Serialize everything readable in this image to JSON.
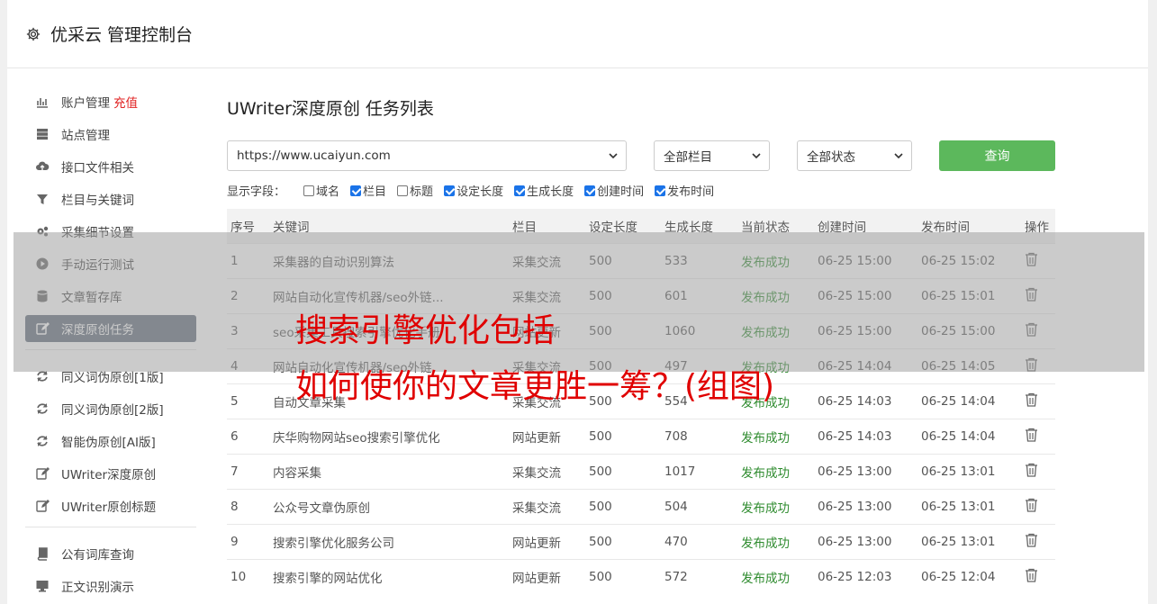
{
  "app": {
    "title": "优采云 管理控制台"
  },
  "sidebar": {
    "items": [
      {
        "label": "账户管理",
        "badge": "充值",
        "icon": "bar-chart-icon"
      },
      {
        "label": "站点管理",
        "icon": "server-icon"
      },
      {
        "label": "接口文件相关",
        "icon": "cloud-upload-icon"
      },
      {
        "label": "栏目与关键词",
        "icon": "filter-icon"
      },
      {
        "label": "采集细节设置",
        "icon": "gears-icon"
      },
      {
        "label": "手动运行测试",
        "icon": "play-icon"
      },
      {
        "label": "文章暂存库",
        "icon": "database-icon"
      },
      {
        "label": "深度原创任务",
        "icon": "edit-icon",
        "active": true
      }
    ],
    "items2": [
      {
        "label": "同义词伪原创[1版]",
        "icon": "refresh-icon"
      },
      {
        "label": "同义词伪原创[2版]",
        "icon": "refresh-icon"
      },
      {
        "label": "智能伪原创[AI版]",
        "icon": "refresh-icon"
      },
      {
        "label": "UWriter深度原创",
        "icon": "edit-icon"
      },
      {
        "label": "UWriter原创标题",
        "icon": "edit-icon"
      }
    ],
    "items3": [
      {
        "label": "公有词库查询",
        "icon": "book-icon"
      },
      {
        "label": "正文识别演示",
        "icon": "monitor-icon"
      }
    ]
  },
  "main": {
    "title": "UWriter深度原创 任务列表",
    "site_select": "https://www.ucaiyun.com",
    "column_select": "全部栏目",
    "status_select": "全部状态",
    "query_label": "查询",
    "fields_label": "显示字段：",
    "fields": [
      {
        "label": "域名",
        "checked": false
      },
      {
        "label": "栏目",
        "checked": true
      },
      {
        "label": "标题",
        "checked": false
      },
      {
        "label": "设定长度",
        "checked": true
      },
      {
        "label": "生成长度",
        "checked": true
      },
      {
        "label": "创建时间",
        "checked": true
      },
      {
        "label": "发布时间",
        "checked": true
      }
    ],
    "columns": [
      "序号",
      "关键词",
      "栏目",
      "设定长度",
      "生成长度",
      "当前状态",
      "创建时间",
      "发布时间",
      "操作"
    ],
    "rows": [
      [
        "1",
        "采集器的自动识别算法",
        "采集交流",
        "500",
        "533",
        "发布成功",
        "06-25 15:00",
        "06-25 15:02"
      ],
      [
        "2",
        "网站自动化宣传机器/seo外链...",
        "采集交流",
        "500",
        "601",
        "发布成功",
        "06-25 15:00",
        "06-25 15:01"
      ],
      [
        "3",
        "seo采集工具搜索引擎优化手册",
        "网站更新",
        "500",
        "1060",
        "发布成功",
        "06-25 15:00",
        "06-25 15:00"
      ],
      [
        "4",
        "网站自动化宣传机器/seo外链",
        "采集交流",
        "500",
        "497",
        "发布成功",
        "06-25 14:04",
        "06-25 14:05"
      ],
      [
        "5",
        "自动文章采集",
        "采集交流",
        "500",
        "554",
        "发布成功",
        "06-25 14:03",
        "06-25 14:04"
      ],
      [
        "6",
        "庆华购物网站seo搜索引擎优化",
        "网站更新",
        "500",
        "708",
        "发布成功",
        "06-25 14:03",
        "06-25 14:04"
      ],
      [
        "7",
        "内容采集",
        "采集交流",
        "500",
        "1017",
        "发布成功",
        "06-25 13:00",
        "06-25 13:01"
      ],
      [
        "8",
        "公众号文章伪原创",
        "采集交流",
        "500",
        "504",
        "发布成功",
        "06-25 13:00",
        "06-25 13:01"
      ],
      [
        "9",
        "搜索引擎优化服务公司",
        "网站更新",
        "500",
        "470",
        "发布成功",
        "06-25 13:00",
        "06-25 13:01"
      ],
      [
        "10",
        "搜索引擎的网站优化",
        "网站更新",
        "500",
        "572",
        "发布成功",
        "06-25 12:03",
        "06-25 12:04"
      ]
    ]
  },
  "overlay": {
    "line1": "搜索引擎优化包括",
    "line2": "如何使你的文章更胜一筹？(组图)"
  },
  "colors": {
    "primary_button": "#5cb85c",
    "active_nav": "#5f6b7a",
    "success": "#2e8b2e",
    "headline": "#e00000",
    "badge": "#e02020"
  }
}
